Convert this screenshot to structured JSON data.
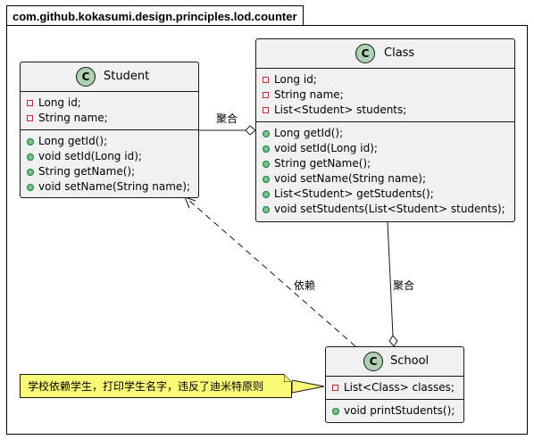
{
  "package": {
    "name": "com.github.kokasumi.design.principles.lod.counter"
  },
  "classes": {
    "student": {
      "name": "Student",
      "badge": "C",
      "fields": [
        "Long id;",
        "String name;"
      ],
      "methods": [
        "Long getId();",
        "void setId(Long id);",
        "String getName();",
        "void setName(String name);"
      ]
    },
    "class": {
      "name": "Class",
      "badge": "C",
      "fields": [
        "Long id;",
        "String name;",
        "List<Student> students;"
      ],
      "methods": [
        "Long getId();",
        "void setId(Long id);",
        "String getName();",
        "void setName(String name);",
        "List<Student> getStudents();",
        "void setStudents(List<Student> students);"
      ]
    },
    "school": {
      "name": "School",
      "badge": "C",
      "fields": [
        "List<Class> classes;"
      ],
      "methods": [
        "void printStudents();"
      ]
    }
  },
  "relations": {
    "student_class": "聚合",
    "class_school": "聚合",
    "school_student": "依赖"
  },
  "note": "学校依赖学生，打印学生名字，违反了迪米特原则",
  "colors": {
    "class_fill": "#f1f1f1",
    "badge_fill": "#add1b2",
    "private_marker": "#c82930",
    "public_marker": "#84be84",
    "note_fill": "#fbfb77"
  }
}
